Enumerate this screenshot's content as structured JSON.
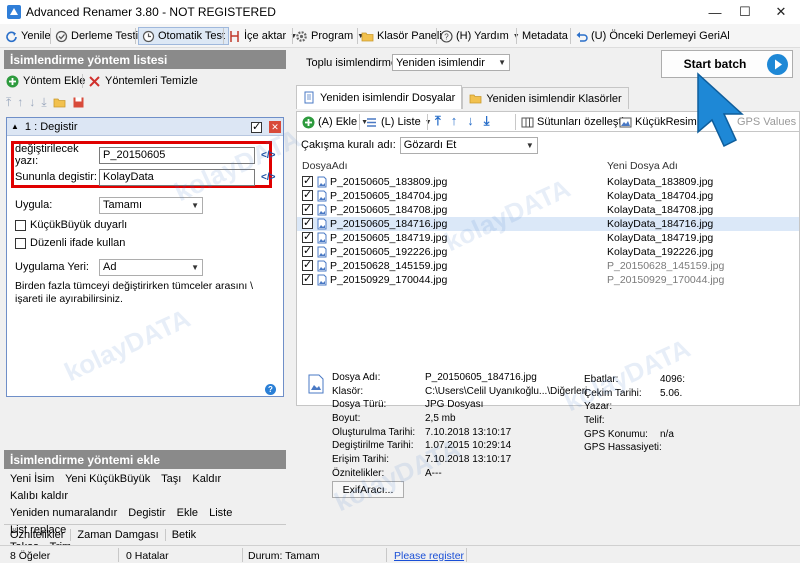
{
  "window": {
    "title": "Advanced Renamer 3.80 - NOT REGISTERED",
    "min": "—",
    "max": "☐",
    "close": "✕"
  },
  "toolbar": {
    "yenile": "Yenile",
    "derleme_testi": "Derleme Testi",
    "otomatik_test": "Otomatik Test",
    "ice_aktar": "İçe aktar",
    "program": "Program",
    "klasor_paneli": "Klasör Paneli",
    "yardim": "(H) Yardım",
    "metadata": "Metadata",
    "onceki": "(U) Önceki Derlemeyi GeriAl"
  },
  "left": {
    "method_list_title": "İsimlendirme yöntem listesi",
    "add_method": "Yöntem Ekle",
    "clear_methods": "Yöntemleri Temizle",
    "method": {
      "header": "1 : Degistir",
      "replace_label": "değiştirilecek yazı:",
      "replace_value": "P_20150605",
      "with_label": "Sununla degistir:",
      "with_value": "KolayData",
      "tag": "</>",
      "apply_label": "Uygula:",
      "apply_value": "Tamamı",
      "case_sensitive": "KüçükBüyük duyarlı",
      "regex": "Düzenli ifade kullan",
      "apply_to_label": "Uygulama Yeri:",
      "apply_to_value": "Ad",
      "help_text": "Birden fazla tümceyi değiştirirken tümceler arasını \\ işareti ile ayırabilirsiniz."
    },
    "add_method_title": "İsimlendirme yöntemi ekle",
    "methods_row1": [
      "Yeni İsim",
      "Yeni KüçükBüyük",
      "Taşı",
      "Kaldır",
      "Kalıbı kaldır"
    ],
    "methods_row2": [
      "Yeniden numaralandır",
      "Degistir",
      "Ekle",
      "Liste",
      "List replace"
    ],
    "methods_row3": [
      "Takas",
      "Trim"
    ],
    "bottom_tabs": [
      "Öznitelikler",
      "Zaman Damgası",
      "Betik"
    ]
  },
  "right": {
    "batch_mode_label": "Toplu isimlendirme mo",
    "batch_mode_value": "Yeniden isimlendir",
    "start_batch": "Start batch",
    "tab_files": "Yeniden isimlendir Dosyalar",
    "tab_folders": "Yeniden isimlendir Klasörler",
    "list_toolbar": {
      "add": "(A) Ekle",
      "list": "(L) Liste",
      "columns": "Sütunları özelleştir",
      "thumbnail": "KüçükResim",
      "gps": "GPS Values"
    },
    "conflict_label": "Çakışma kuralı adı:",
    "conflict_value": "Gözardı Et",
    "col_name": "DosyaAdı",
    "col_new": "Yeni Dosya Adı",
    "files": [
      {
        "name": "P_20150605_183809.jpg",
        "new": "KolayData_183809.jpg",
        "changed": true
      },
      {
        "name": "P_20150605_184704.jpg",
        "new": "KolayData_184704.jpg",
        "changed": true
      },
      {
        "name": "P_20150605_184708.jpg",
        "new": "KolayData_184708.jpg",
        "changed": true
      },
      {
        "name": "P_20150605_184716.jpg",
        "new": "KolayData_184716.jpg",
        "changed": true
      },
      {
        "name": "P_20150605_184719.jpg",
        "new": "KolayData_184719.jpg",
        "changed": true
      },
      {
        "name": "P_20150605_192226.jpg",
        "new": "KolayData_192226.jpg",
        "changed": true
      },
      {
        "name": "P_20150628_145159.jpg",
        "new": "P_20150628_145159.jpg",
        "changed": false
      },
      {
        "name": "P_20150929_170044.jpg",
        "new": "P_20150929_170044.jpg",
        "changed": false
      }
    ],
    "info": {
      "labels": [
        "Dosya Adı:",
        "Klasör:",
        "Dosya Türü:",
        "Boyut:",
        "Oluşturulma Tarihi:",
        "Degiştirilme Tarihi:",
        "Erişim Tarihi:",
        "Öznitelikler:"
      ],
      "values": [
        "P_20150605_184716.jpg",
        "C:\\Users\\Celil Uyanıkoğlu...\\Diğerleri",
        "JPG Dosyası",
        "2,5 mb",
        "7.10.2018 13:10:17",
        "1.07.2015 10:29:14",
        "7.10.2018 13:10:17",
        "A---"
      ],
      "labels2": [
        "Ebatlar:",
        "Çekim Tarihi:",
        "Yazar:",
        "Telif:",
        "GPS Konumu:",
        "GPS Hassasiyeti:"
      ],
      "values2": [
        "4096:",
        "5.06.",
        "",
        "",
        "n/a",
        ""
      ],
      "exif_button": "ExifAracı..."
    }
  },
  "status": {
    "items": "8 Öğeler",
    "errors": "0 Hatalar",
    "state": "Durum: Tamam",
    "register": "Please register"
  },
  "watermark": "kolayDATA",
  "colors": {
    "highlight": "#e00000",
    "arrow": "#1e88d6",
    "selected_row": "#dbe8f8",
    "section": "#8a8a8a"
  }
}
